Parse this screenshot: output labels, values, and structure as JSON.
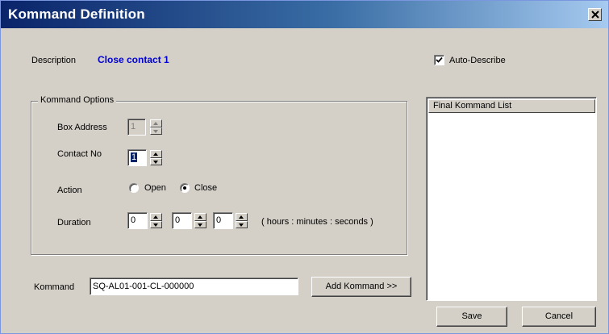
{
  "window": {
    "title": "Kommand Definition"
  },
  "description": {
    "label": "Description",
    "value": "Close contact 1"
  },
  "auto_describe": {
    "label": "Auto-Describe",
    "checked": true
  },
  "options": {
    "group_label": "Kommand Options",
    "box_address": {
      "label": "Box Address",
      "value": "1",
      "enabled": false
    },
    "contact_no": {
      "label": "Contact No",
      "value": "1"
    },
    "action": {
      "label": "Action",
      "open_label": "Open",
      "close_label": "Close",
      "selected": "Close"
    },
    "duration": {
      "label": "Duration",
      "hours": "0",
      "minutes": "0",
      "seconds": "0",
      "hint": "( hours : minutes : seconds )"
    }
  },
  "kommand": {
    "label": "Kommand",
    "value": "SQ-AL01-001-CL-000000",
    "add_button": "Add Kommand >>"
  },
  "final_list": {
    "header": "Final Kommand List",
    "items": []
  },
  "buttons": {
    "save": "Save",
    "cancel": "Cancel"
  }
}
